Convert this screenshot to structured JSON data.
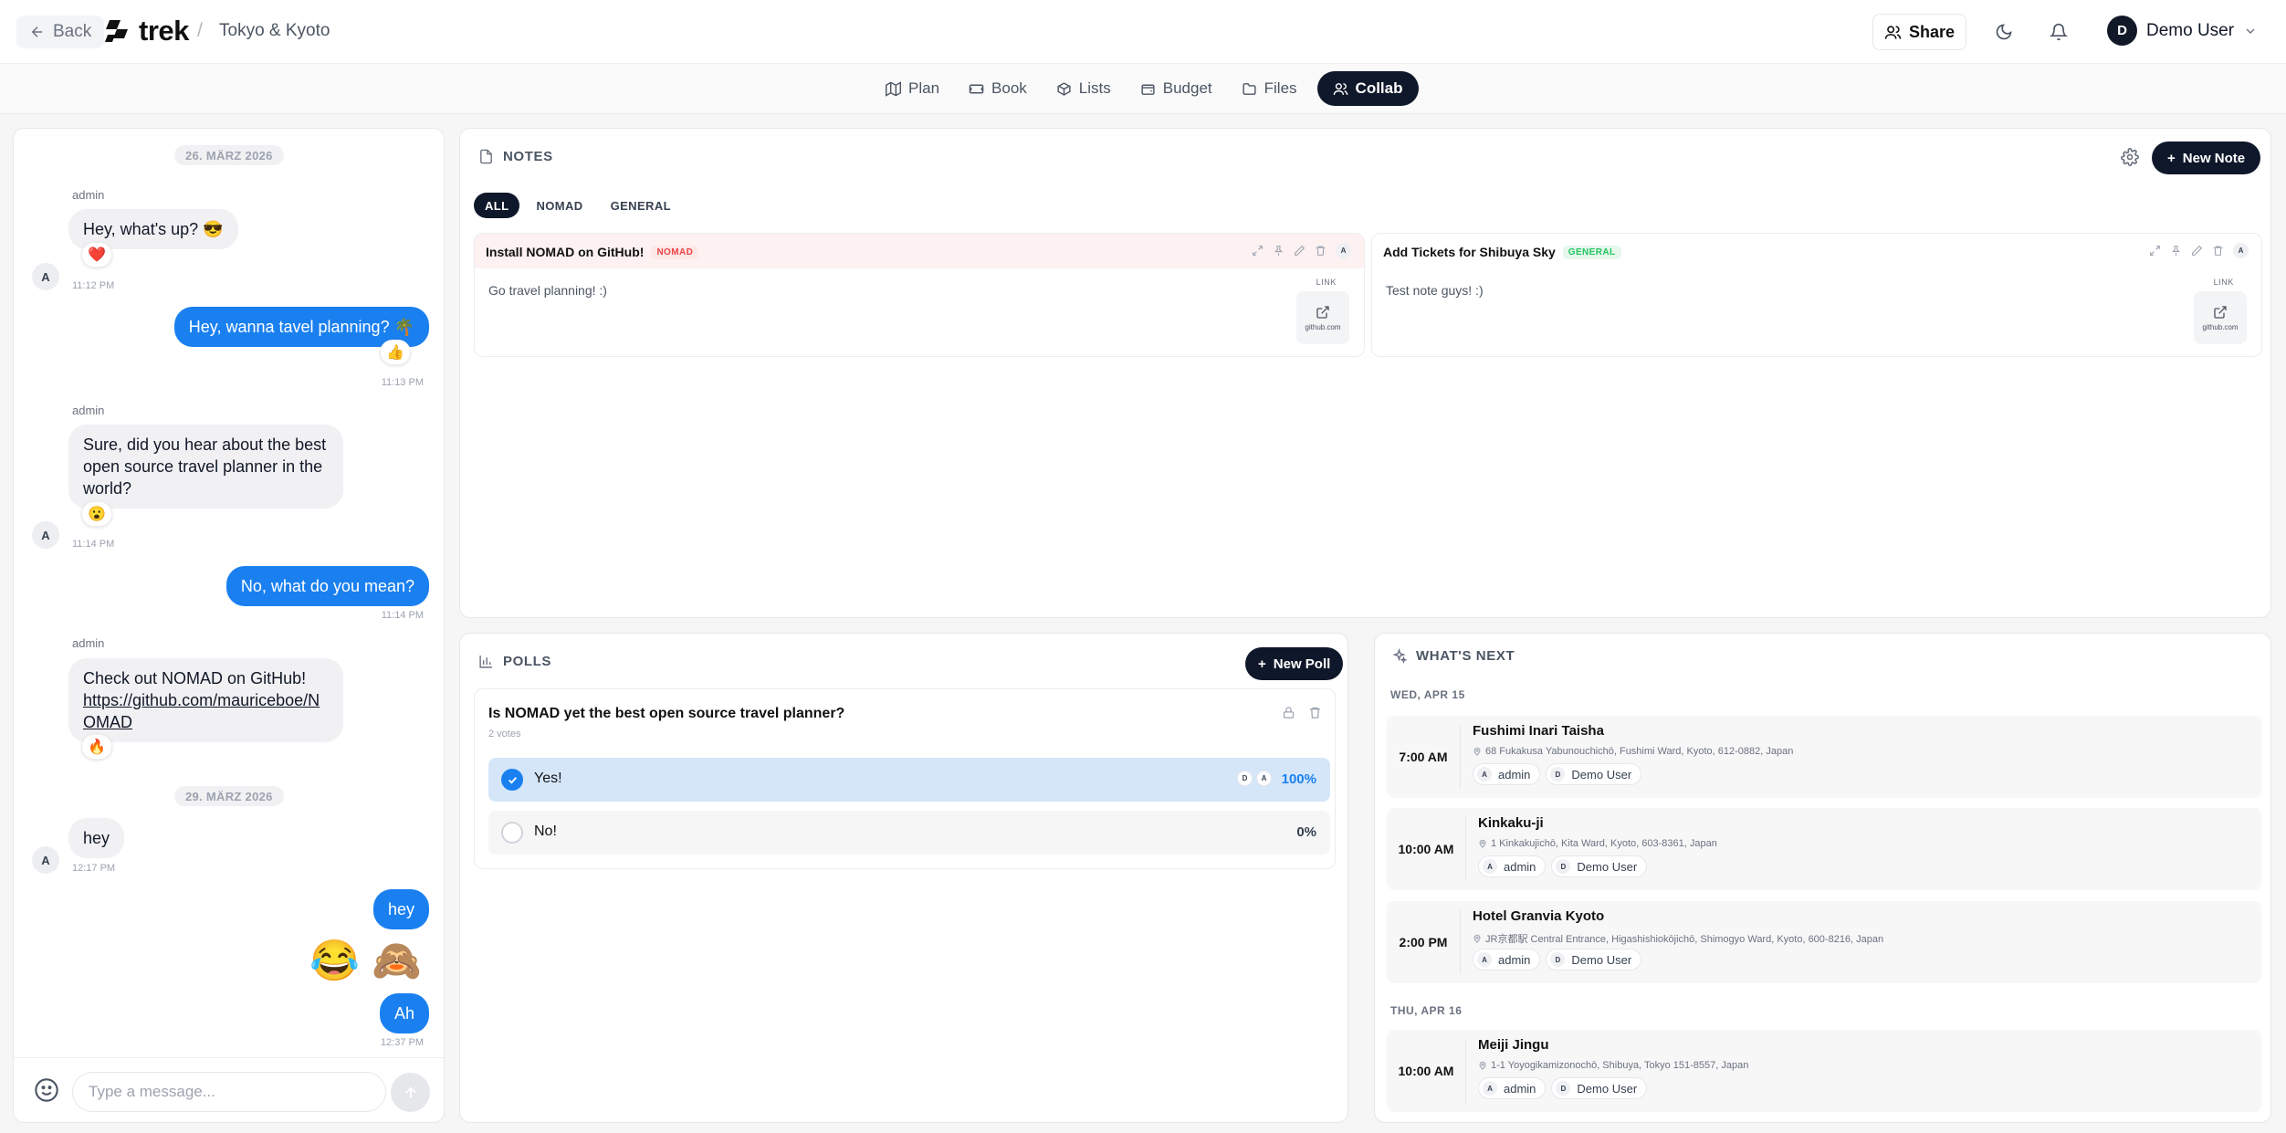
{
  "header": {
    "back_label": "Back",
    "logo_text": "trek",
    "separator": "/",
    "trip_name": "Tokyo & Kyoto",
    "share_label": "Share",
    "user_initial": "D",
    "user_name": "Demo User"
  },
  "tabs": [
    {
      "label": "Plan",
      "icon": "map-icon"
    },
    {
      "label": "Book",
      "icon": "ticket-icon"
    },
    {
      "label": "Lists",
      "icon": "package-icon"
    },
    {
      "label": "Budget",
      "icon": "wallet-icon"
    },
    {
      "label": "Files",
      "icon": "folder-icon"
    },
    {
      "label": "Collab",
      "icon": "users-icon",
      "active": true
    }
  ],
  "chat": {
    "dates": [
      "26. MÄRZ 2026",
      "29. MÄRZ 2026"
    ],
    "messages": [
      {
        "sender": "admin",
        "avatar": "A",
        "text": "Hey, what's up? 😎",
        "reaction": "❤️",
        "time": "11:12 PM"
      },
      {
        "sender": "me",
        "text": "Hey, wanna tavel planning? 🌴",
        "reaction": "👍",
        "time": "11:13 PM"
      },
      {
        "sender": "admin",
        "avatar": "A",
        "text_lines": [
          "Sure, did you hear about the best",
          "open source travel planner in the",
          "world?"
        ],
        "reaction": "😮",
        "time": "11:14 PM"
      },
      {
        "sender": "me",
        "text": "No, what do you mean?",
        "time": "11:14 PM"
      },
      {
        "sender": "admin",
        "avatar": "A",
        "text": "Check out NOMAD on GitHub!",
        "link_lines": [
          "https://github.com/mauriceboe/N",
          "OMAD"
        ],
        "reaction": "🔥"
      },
      {
        "sender": "admin",
        "avatar": "A",
        "text": "hey",
        "time": "12:17 PM"
      },
      {
        "sender": "me",
        "text": "hey"
      },
      {
        "sender": "me",
        "emojis": [
          "😂",
          "🙈"
        ]
      },
      {
        "sender": "me",
        "text": "Ah",
        "time": "12:37 PM"
      }
    ],
    "input_placeholder": "Type a message..."
  },
  "notes": {
    "title": "NOTES",
    "new_label": "New Note",
    "filters": [
      "ALL",
      "NOMAD",
      "GENERAL"
    ],
    "cards": [
      {
        "title": "Install NOMAD on GitHub!",
        "category": "NOMAD",
        "category_color": "#ef4444",
        "category_bg": "#fde8e8",
        "header_bg": "#fdf1f1",
        "body": "Go travel planning! :)",
        "author": "A",
        "link_label": "LINK",
        "link_domain": "github.com"
      },
      {
        "title": "Add Tickets for Shibuya Sky",
        "category": "GENERAL",
        "category_color": "#22c55e",
        "category_bg": "#e6f7ec",
        "header_bg": "#ffffff",
        "body": "Test note guys! :)",
        "author": "A",
        "link_label": "LINK",
        "link_domain": "github.com"
      }
    ]
  },
  "polls": {
    "title": "POLLS",
    "new_label": "New Poll",
    "question": "Is NOMAD yet the best open source travel planner?",
    "votes": "2 votes",
    "options": [
      {
        "label": "Yes!",
        "percent": "100%",
        "voters": [
          "D",
          "A"
        ],
        "selected": true
      },
      {
        "label": "No!",
        "percent": "0%",
        "voters": [],
        "selected": false
      }
    ]
  },
  "whats_next": {
    "title": "WHAT'S NEXT",
    "days": [
      {
        "label": "WED, APR 15",
        "events": [
          {
            "time": "7:00 AM",
            "name": "Fushimi Inari Taisha",
            "address": "68 Fukakusa Yabunouchichō, Fushimi Ward, Kyoto, 612-0882, Japan",
            "people": [
              {
                "initial": "A",
                "name": "admin"
              },
              {
                "initial": "D",
                "name": "Demo User"
              }
            ]
          },
          {
            "time": "10:00 AM",
            "name": "Kinkaku-ji",
            "address": "1 Kinkakujichō, Kita Ward, Kyoto, 603-8361, Japan",
            "people": [
              {
                "initial": "A",
                "name": "admin"
              },
              {
                "initial": "D",
                "name": "Demo User"
              }
            ]
          },
          {
            "time": "2:00 PM",
            "name": "Hotel Granvia Kyoto",
            "address": "JR京都駅 Central Entrance, Higashishiokōjichō, Shimogyo Ward, Kyoto, 600-8216, Japan",
            "people": [
              {
                "initial": "A",
                "name": "admin"
              },
              {
                "initial": "D",
                "name": "Demo User"
              }
            ]
          }
        ]
      },
      {
        "label": "THU, APR 16",
        "events": [
          {
            "time": "10:00 AM",
            "name": "Meiji Jingu",
            "address": "1-1 Yoyogikamizonochō, Shibuya, Tokyo 151-8557, Japan",
            "people": [
              {
                "initial": "A",
                "name": "admin"
              },
              {
                "initial": "D",
                "name": "Demo User"
              }
            ]
          }
        ]
      }
    ]
  },
  "colors": {
    "accent_blue": "#1a80f0",
    "dark": "#0f172a"
  }
}
